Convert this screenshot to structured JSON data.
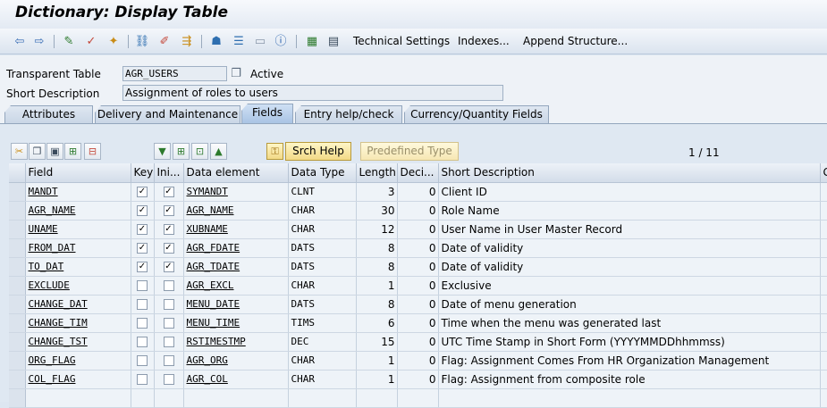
{
  "title": "Dictionary: Display Table",
  "toolbar": {
    "technical_settings": "Technical Settings",
    "indexes": "Indexes...",
    "append_structure": "Append Structure..."
  },
  "header": {
    "table_label": "Transparent Table",
    "table_value": "AGR_USERS",
    "status": "Active",
    "short_desc_label": "Short Description",
    "short_desc_value": "Assignment of roles to users"
  },
  "tabs": [
    {
      "label": "Attributes"
    },
    {
      "label": "Delivery and Maintenance"
    },
    {
      "label": "Fields"
    },
    {
      "label": "Entry help/check"
    },
    {
      "label": "Currency/Quantity Fields"
    }
  ],
  "active_tab": "Fields",
  "table_toolbar": {
    "srch_help": "Srch Help",
    "predefined_type": "Predefined Type",
    "pager": "1 / 11"
  },
  "columns": [
    "Field",
    "Key",
    "Ini...",
    "Data element",
    "Data Type",
    "Length",
    "Deci...",
    "Short Description",
    "G"
  ],
  "rows": [
    {
      "field": "MANDT",
      "key": true,
      "ini": true,
      "elem": "SYMANDT",
      "type": "CLNT",
      "len": "3",
      "dec": "0",
      "desc": "Client ID"
    },
    {
      "field": "AGR_NAME",
      "key": true,
      "ini": true,
      "elem": "AGR_NAME",
      "type": "CHAR",
      "len": "30",
      "dec": "0",
      "desc": "Role Name"
    },
    {
      "field": "UNAME",
      "key": true,
      "ini": true,
      "elem": "XUBNAME",
      "type": "CHAR",
      "len": "12",
      "dec": "0",
      "desc": "User Name in User Master Record"
    },
    {
      "field": "FROM_DAT",
      "key": true,
      "ini": true,
      "elem": "AGR_FDATE",
      "type": "DATS",
      "len": "8",
      "dec": "0",
      "desc": "Date of validity"
    },
    {
      "field": "TO_DAT",
      "key": true,
      "ini": true,
      "elem": "AGR_TDATE",
      "type": "DATS",
      "len": "8",
      "dec": "0",
      "desc": "Date of validity"
    },
    {
      "field": "EXCLUDE",
      "key": false,
      "ini": false,
      "elem": "AGR_EXCL",
      "type": "CHAR",
      "len": "1",
      "dec": "0",
      "desc": "Exclusive"
    },
    {
      "field": "CHANGE_DAT",
      "key": false,
      "ini": false,
      "elem": "MENU_DATE",
      "type": "DATS",
      "len": "8",
      "dec": "0",
      "desc": "Date of menu generation"
    },
    {
      "field": "CHANGE_TIM",
      "key": false,
      "ini": false,
      "elem": "MENU_TIME",
      "type": "TIMS",
      "len": "6",
      "dec": "0",
      "desc": "Time when the menu was generated last"
    },
    {
      "field": "CHANGE_TST",
      "key": false,
      "ini": false,
      "elem": "RSTIMESTMP",
      "type": "DEC",
      "len": "15",
      "dec": "0",
      "desc": "UTC Time Stamp in Short Form (YYYYMMDDhhmmss)"
    },
    {
      "field": "ORG_FLAG",
      "key": false,
      "ini": false,
      "elem": "AGR_ORG",
      "type": "CHAR",
      "len": "1",
      "dec": "0",
      "desc": "Flag: Assignment Comes From HR Organization Management"
    },
    {
      "field": "COL_FLAG",
      "key": false,
      "ini": false,
      "elem": "AGR_COL",
      "type": "CHAR",
      "len": "1",
      "dec": "0",
      "desc": "Flag: Assignment from composite role"
    }
  ],
  "colors": {
    "accent": "#a9c4e4",
    "button": "#f2d986"
  }
}
